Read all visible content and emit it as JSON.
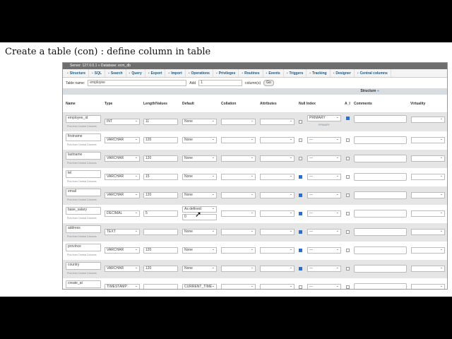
{
  "slide_title": "Create a table (con) : define column in table",
  "breadcrumb": {
    "server": "Server: 127.0.0.1",
    "database": "Database: ecm_db"
  },
  "tabs": [
    "Structure",
    "SQL",
    "Search",
    "Query",
    "Export",
    "Import",
    "Operations",
    "Privileges",
    "Routines",
    "Events",
    "Triggers",
    "Tracking",
    "Designer",
    "Central columns"
  ],
  "form": {
    "table_name_label": "Table name:",
    "table_name": "employee",
    "add_label": "Add",
    "add_value": "1",
    "columns_label": "column(s)",
    "go": "Go"
  },
  "structure_label": "Structure",
  "headers": {
    "name": "Name",
    "type": "Type",
    "length": "Length/Values",
    "default": "Default",
    "collation": "Collation",
    "attributes": "Attributes",
    "null_index": "Null  Index",
    "ai": "A_I",
    "comments": "Comments",
    "virtuality": "Virtuality"
  },
  "pick_label": "Pick from Central Columns",
  "rows": [
    {
      "name": "employee_id",
      "type": "INT",
      "length": "11",
      "default": "None",
      "null": false,
      "index": "PRIMARY",
      "index_note": "PRIMARY",
      "ai": true
    },
    {
      "name": "firstname",
      "type": "VARCHAR",
      "length": "120",
      "default": "None",
      "null": false,
      "index": "---",
      "ai": false
    },
    {
      "name": "lastname",
      "type": "VARCHAR",
      "length": "120",
      "default": "None",
      "null": false,
      "index": "---",
      "ai": false
    },
    {
      "name": "tel",
      "type": "VARCHAR",
      "length": "15",
      "default": "None",
      "null": true,
      "index": "---",
      "ai": false
    },
    {
      "name": "email",
      "type": "VARCHAR",
      "length": "120",
      "default": "None",
      "null": true,
      "index": "---",
      "ai": false
    },
    {
      "name": "base_salary",
      "type": "DECIMAL",
      "length": "5",
      "default": "As defined:",
      "default_value": "0",
      "null": true,
      "index": "---",
      "ai": false
    },
    {
      "name": "address",
      "type": "TEXT",
      "length": "",
      "default": "None",
      "null": true,
      "index": "---",
      "ai": false
    },
    {
      "name": "province",
      "type": "VARCHAR",
      "length": "120",
      "default": "None",
      "null": true,
      "index": "---",
      "ai": false
    },
    {
      "name": "country",
      "type": "VARCHAR",
      "length": "120",
      "default": "None",
      "null": true,
      "index": "---",
      "ai": false
    },
    {
      "name": "create_at",
      "type": "TIMESTAMP",
      "length": "",
      "default": "CURRENT_TIME",
      "null": false,
      "index": "---",
      "ai": false
    }
  ]
}
